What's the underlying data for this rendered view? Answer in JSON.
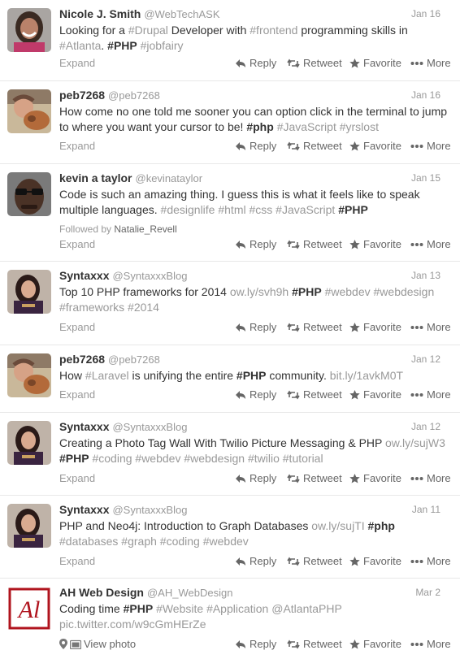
{
  "actions": {
    "expand": "Expand",
    "view_photo": "View photo",
    "reply": "Reply",
    "retweet": "Retweet",
    "favorite": "Favorite",
    "more": "More",
    "followed_by_prefix": "Followed by"
  },
  "tweets": [
    {
      "name": "Nicole J. Smith",
      "handle": "@WebTechASK",
      "date": "Jan 16",
      "avatar": "woman-smiling-avatar",
      "tokens": [
        {
          "t": "Looking for a ",
          "k": "tok"
        },
        {
          "t": "#Drupal",
          "k": "hash-s"
        },
        {
          "t": " Developer with ",
          "k": "tok"
        },
        {
          "t": "#frontend",
          "k": "hash-s"
        },
        {
          "t": " programming skills in ",
          "k": "tok"
        },
        {
          "t": "#Atlanta",
          "k": "hash-s"
        },
        {
          "t": ". ",
          "k": "tok"
        },
        {
          "t": "#PHP",
          "k": "hash-w bold"
        },
        {
          "t": " ",
          "k": "tok"
        },
        {
          "t": "#jobfairy",
          "k": "hash-s"
        }
      ]
    },
    {
      "name": "peb7268",
      "handle": "@peb7268",
      "date": "Jan 16",
      "avatar": "man-with-dog-avatar",
      "tokens": [
        {
          "t": "How come no one told me sooner you can option click in the terminal to jump to where you want your cursor to be!  ",
          "k": "tok"
        },
        {
          "t": "#php",
          "k": "hash-w bold"
        },
        {
          "t": " ",
          "k": "tok"
        },
        {
          "t": "#JavaScript",
          "k": "hash-s"
        },
        {
          "t": " ",
          "k": "tok"
        },
        {
          "t": "#yrslost",
          "k": "hash-s"
        }
      ]
    },
    {
      "name": "kevin a taylor",
      "handle": "@kevinataylor",
      "date": "Jan 15",
      "avatar": "man-glasses-avatar",
      "followed_by": "Natalie_Revell",
      "tokens": [
        {
          "t": "Code is such an amazing thing. I guess this is what it feels like to speak multiple languages. ",
          "k": "tok"
        },
        {
          "t": "#designlife",
          "k": "hash-s"
        },
        {
          "t": " ",
          "k": "tok"
        },
        {
          "t": "#html",
          "k": "hash-s"
        },
        {
          "t": " ",
          "k": "tok"
        },
        {
          "t": "#css",
          "k": "hash-s"
        },
        {
          "t": " ",
          "k": "tok"
        },
        {
          "t": "#JavaScript",
          "k": "hash-s"
        },
        {
          "t": " ",
          "k": "tok"
        },
        {
          "t": "#PHP",
          "k": "hash-w bold"
        }
      ]
    },
    {
      "name": "Syntaxxx",
      "handle": "@SyntaxxxBlog",
      "date": "Jan 13",
      "avatar": "woman-dark-hair-avatar",
      "tokens": [
        {
          "t": "Top 10 PHP frameworks for 2014 ",
          "k": "tok"
        },
        {
          "t": "ow.ly/svh9h",
          "k": "hash-s"
        },
        {
          "t": " ",
          "k": "tok"
        },
        {
          "t": "#PHP",
          "k": "hash-w bold"
        },
        {
          "t": " ",
          "k": "tok"
        },
        {
          "t": "#webdev",
          "k": "hash-s"
        },
        {
          "t": " ",
          "k": "tok"
        },
        {
          "t": "#webdesign",
          "k": "hash-s"
        },
        {
          "t": " ",
          "k": "tok"
        },
        {
          "t": "#frameworks",
          "k": "hash-s"
        },
        {
          "t": " ",
          "k": "tok"
        },
        {
          "t": "#2014",
          "k": "hash-s"
        }
      ]
    },
    {
      "name": "peb7268",
      "handle": "@peb7268",
      "date": "Jan 12",
      "avatar": "man-with-dog-avatar",
      "tokens": [
        {
          "t": "How ",
          "k": "tok"
        },
        {
          "t": "#Laravel",
          "k": "hash-s"
        },
        {
          "t": " is unifying the entire ",
          "k": "tok"
        },
        {
          "t": "#PHP",
          "k": "hash-w bold"
        },
        {
          "t": " community.  ",
          "k": "tok"
        },
        {
          "t": "bit.ly/1avkM0T",
          "k": "hash-s"
        }
      ]
    },
    {
      "name": "Syntaxxx",
      "handle": "@SyntaxxxBlog",
      "date": "Jan 12",
      "avatar": "woman-dark-hair-avatar",
      "tokens": [
        {
          "t": "Creating a Photo Tag Wall With Twilio Picture Messaging & PHP ",
          "k": "tok"
        },
        {
          "t": "ow.ly/sujW3",
          "k": "hash-s"
        },
        {
          "t": " ",
          "k": "tok"
        },
        {
          "t": "#PHP",
          "k": "hash-w bold"
        },
        {
          "t": " ",
          "k": "tok"
        },
        {
          "t": "#coding",
          "k": "hash-s"
        },
        {
          "t": "  ",
          "k": "tok"
        },
        {
          "t": "#webdev",
          "k": "hash-s"
        },
        {
          "t": " ",
          "k": "tok"
        },
        {
          "t": "#webdesign",
          "k": "hash-s"
        },
        {
          "t": " ",
          "k": "tok"
        },
        {
          "t": "#twilio",
          "k": "hash-s"
        },
        {
          "t": " ",
          "k": "tok"
        },
        {
          "t": "#tutorial",
          "k": "hash-s"
        }
      ]
    },
    {
      "name": "Syntaxxx",
      "handle": "@SyntaxxxBlog",
      "date": "Jan 11",
      "avatar": "woman-dark-hair-avatar",
      "tokens": [
        {
          "t": "PHP and Neo4j: Introduction to Graph Databases ",
          "k": "tok"
        },
        {
          "t": "ow.ly/sujTI",
          "k": "hash-s"
        },
        {
          "t": " ",
          "k": "tok"
        },
        {
          "t": "#php",
          "k": "hash-w bold"
        },
        {
          "t": " ",
          "k": "tok"
        },
        {
          "t": "#databases",
          "k": "hash-s"
        },
        {
          "t": " ",
          "k": "tok"
        },
        {
          "t": "#graph",
          "k": "hash-s"
        },
        {
          "t": " ",
          "k": "tok"
        },
        {
          "t": "#coding",
          "k": "hash-s"
        },
        {
          "t": " ",
          "k": "tok"
        },
        {
          "t": "#webdev",
          "k": "hash-s"
        }
      ]
    },
    {
      "name": "AH Web Design",
      "handle": "@AH_WebDesign",
      "date": "Mar 2",
      "avatar": "ah-logo-avatar",
      "logo_text": "Al",
      "has_photo": true,
      "tokens": [
        {
          "t": "Coding time ",
          "k": "tok"
        },
        {
          "t": "#PHP",
          "k": "hash-w bold"
        },
        {
          "t": " ",
          "k": "tok"
        },
        {
          "t": "#Website",
          "k": "hash-s"
        },
        {
          "t": " ",
          "k": "tok"
        },
        {
          "t": "#Application",
          "k": "hash-s"
        },
        {
          "t": " ",
          "k": "tok"
        },
        {
          "t": "@AtlantaPHP",
          "k": "hash-s"
        },
        {
          "t": " ",
          "k": "tok"
        },
        {
          "t": "pic.twitter.com/w9cGmHErZe",
          "k": "hash-s"
        }
      ]
    }
  ]
}
